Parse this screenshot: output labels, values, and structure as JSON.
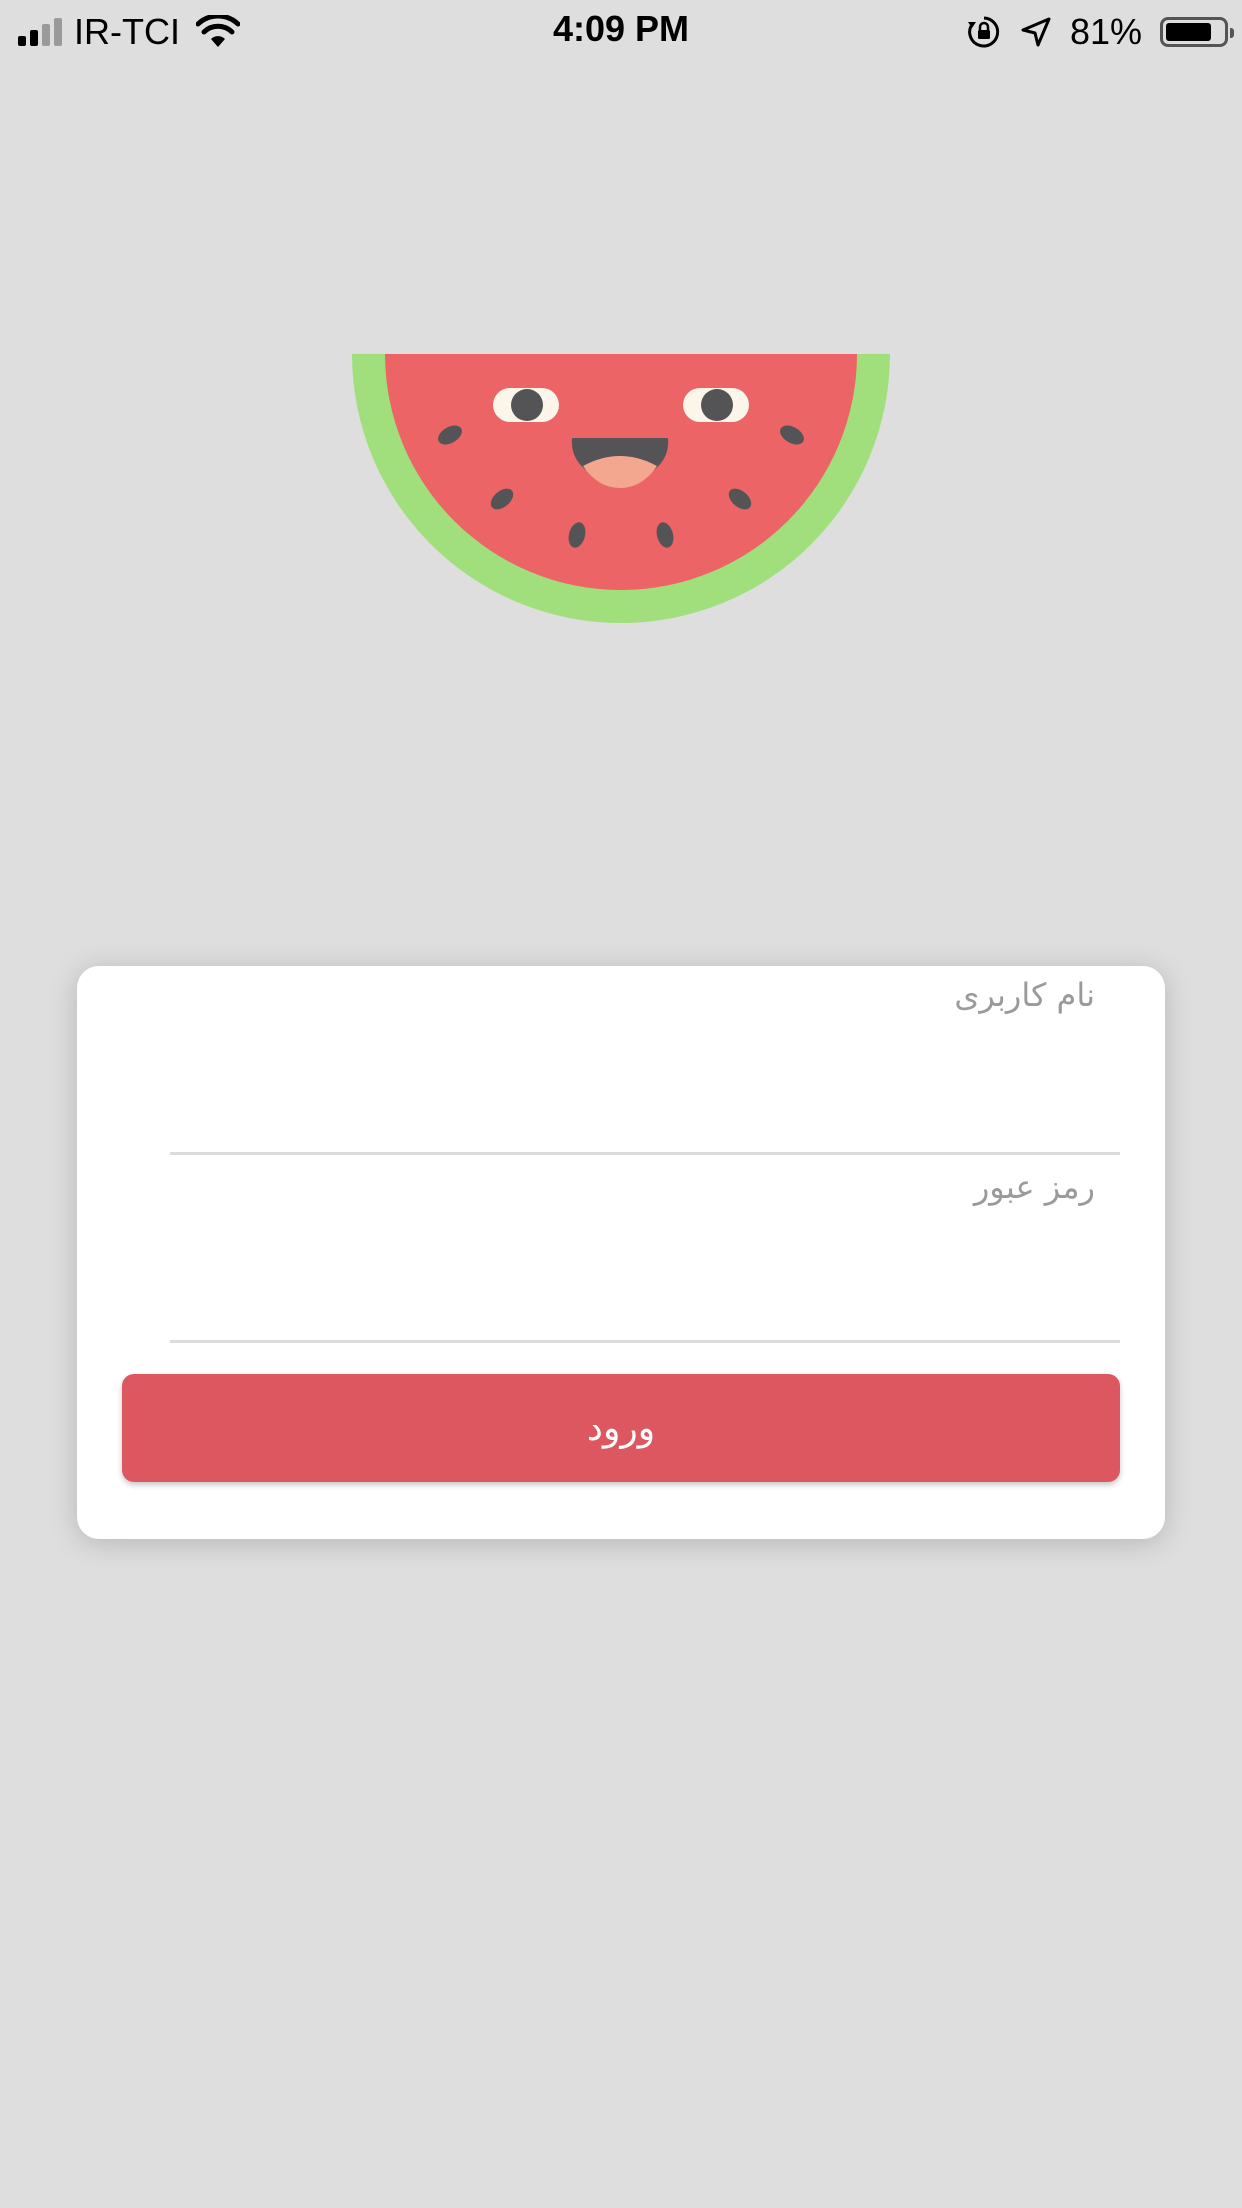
{
  "status_bar": {
    "carrier": "IR-TCI",
    "time": "4:09 PM",
    "battery_percent": "81%",
    "battery_level": 0.81,
    "icons": [
      "signal-icon",
      "wifi-icon",
      "orientation-lock-icon",
      "location-arrow-icon",
      "battery-icon"
    ]
  },
  "logo": {
    "icon": "watermelon-logo",
    "colors": {
      "rind": "#a1df7c",
      "flesh": "#ec6465",
      "seeds": "#545456",
      "eyes": "#fbf5ea",
      "tongue": "#f4a78f"
    }
  },
  "login_form": {
    "username_label": "نام کاربری",
    "username_value": "",
    "password_label": "رمز عبور",
    "password_value": "",
    "submit_label": "ورود",
    "accent_color": "#dd5760"
  }
}
